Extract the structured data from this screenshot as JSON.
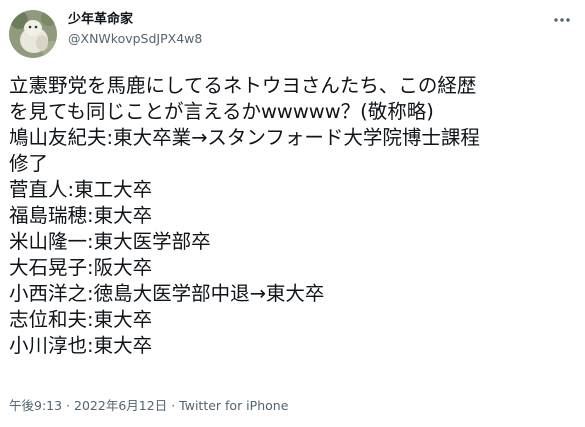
{
  "author": {
    "display_name": "少年革命家",
    "handle": "@XNWkovpSdJPX4w8",
    "avatar": "avatar-image"
  },
  "menu_icon": "more-horizontal-icon",
  "tweet": {
    "lines": [
      "立憲野党を馬鹿にしてるネトウヨさんたち、この経歴",
      "を見ても同じことが言えるかwwwww？(敬称略)",
      "鳩山友紀夫:東大卒業→スタンフォード大学院博士課程",
      "修了",
      "菅直人:東工大卒",
      "福島瑞穂:東大卒",
      "米山隆一:東大医学部卒",
      "大石晃子:阪大卒",
      "小西洋之:徳島大医学部中退→東大卒",
      "志位和夫:東大卒",
      "小川淳也:東大卒"
    ]
  },
  "meta": {
    "time": "午後9:13",
    "separator": "·",
    "date": "2022年6月12日",
    "source": "Twitter for iPhone"
  }
}
